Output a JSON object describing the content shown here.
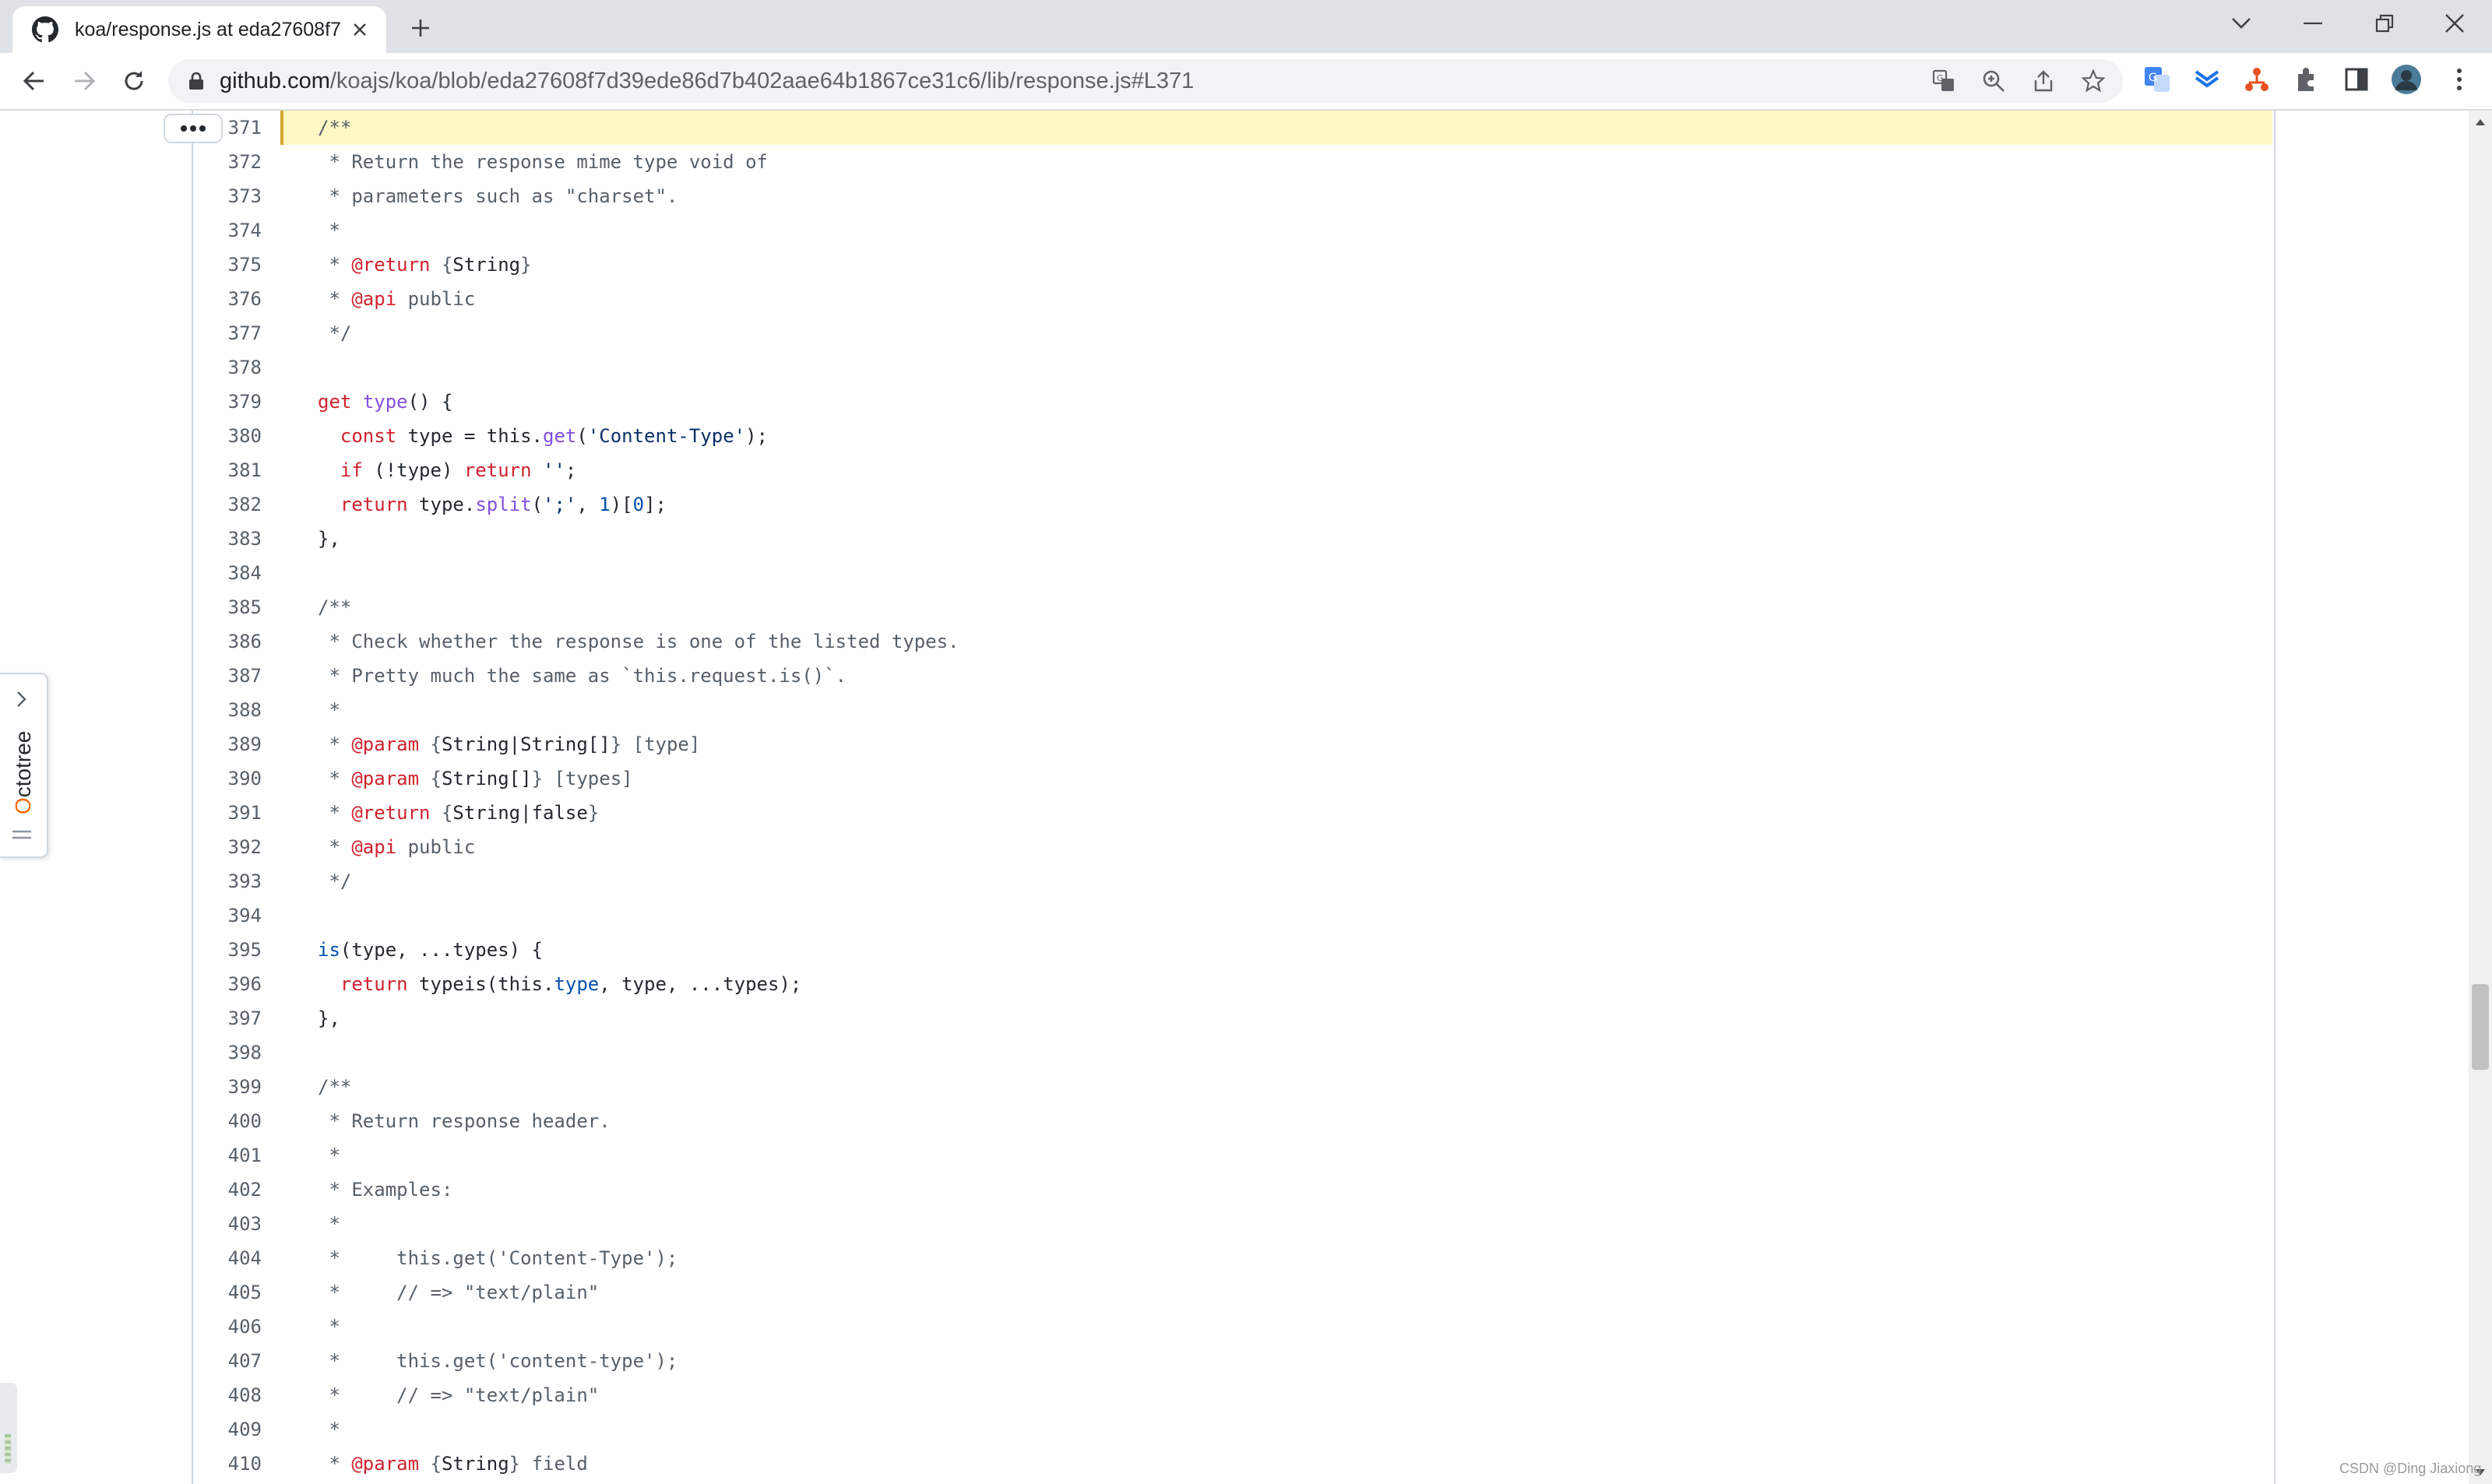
{
  "browser": {
    "tab_title": "koa/response.js at eda27608f7",
    "url_host": "github.com",
    "url_path": "/koajs/koa/blob/eda27608f7d39ede86d7b402aae64b1867ce31c6/lib/response.js#L371"
  },
  "octotree": {
    "label_first": "O",
    "label_rest": "ctotree"
  },
  "code_lines": [
    {
      "n": "371",
      "html": "<span class=\"c\">/**</span>"
    },
    {
      "n": "372",
      "html": "<span class=\"c\"> * Return the response mime type void of</span>"
    },
    {
      "n": "373",
      "html": "<span class=\"c\"> * parameters such as \"charset\".</span>"
    },
    {
      "n": "374",
      "html": "<span class=\"c\"> *</span>"
    },
    {
      "n": "375",
      "html": "<span class=\"c\"> * </span><span class=\"k\">@return</span><span class=\"c\"> {</span>String<span class=\"c\">}</span>"
    },
    {
      "n": "376",
      "html": "<span class=\"c\"> * </span><span class=\"k\">@api</span><span class=\"c\"> public</span>"
    },
    {
      "n": "377",
      "html": "<span class=\"c\"> */</span>"
    },
    {
      "n": "378",
      "html": ""
    },
    {
      "n": "379",
      "html": "<span class=\"k\">get</span> <span class=\"f\">type</span>() {"
    },
    {
      "n": "380",
      "html": "  <span class=\"k\">const</span> type = this.<span class=\"f\">get</span>(<span class=\"s\">'Content-Type'</span>);"
    },
    {
      "n": "381",
      "html": "  <span class=\"k\">if</span> (!type) <span class=\"k\">return</span> <span class=\"s\">''</span>;"
    },
    {
      "n": "382",
      "html": "  <span class=\"k\">return</span> type.<span class=\"f\">split</span>(<span class=\"s\">';'</span>, <span class=\"n\">1</span>)[<span class=\"n\">0</span>];"
    },
    {
      "n": "383",
      "html": "},"
    },
    {
      "n": "384",
      "html": ""
    },
    {
      "n": "385",
      "html": "<span class=\"c\">/**</span>"
    },
    {
      "n": "386",
      "html": "<span class=\"c\"> * Check whether the response is one of the listed types.</span>"
    },
    {
      "n": "387",
      "html": "<span class=\"c\"> * Pretty much the same as `this.request.is()`.</span>"
    },
    {
      "n": "388",
      "html": "<span class=\"c\"> *</span>"
    },
    {
      "n": "389",
      "html": "<span class=\"c\"> * </span><span class=\"k\">@param</span><span class=\"c\"> {</span>String|String[]<span class=\"c\">} [type]</span>"
    },
    {
      "n": "390",
      "html": "<span class=\"c\"> * </span><span class=\"k\">@param</span><span class=\"c\"> {</span>String[]<span class=\"c\">} [types]</span>"
    },
    {
      "n": "391",
      "html": "<span class=\"c\"> * </span><span class=\"k\">@return</span><span class=\"c\"> {</span>String|false<span class=\"c\">}</span>"
    },
    {
      "n": "392",
      "html": "<span class=\"c\"> * </span><span class=\"k\">@api</span><span class=\"c\"> public</span>"
    },
    {
      "n": "393",
      "html": "<span class=\"c\"> */</span>"
    },
    {
      "n": "394",
      "html": ""
    },
    {
      "n": "395",
      "html": "<span class=\"n\">is</span>(type, ...types) {"
    },
    {
      "n": "396",
      "html": "  <span class=\"k\">return</span> typeis(this.<span class=\"n\">type</span>, type, ...types);"
    },
    {
      "n": "397",
      "html": "},"
    },
    {
      "n": "398",
      "html": ""
    },
    {
      "n": "399",
      "html": "<span class=\"c\">/**</span>"
    },
    {
      "n": "400",
      "html": "<span class=\"c\"> * Return response header.</span>"
    },
    {
      "n": "401",
      "html": "<span class=\"c\"> *</span>"
    },
    {
      "n": "402",
      "html": "<span class=\"c\"> * Examples:</span>"
    },
    {
      "n": "403",
      "html": "<span class=\"c\"> *</span>"
    },
    {
      "n": "404",
      "html": "<span class=\"c\"> *     this.get('Content-Type');</span>"
    },
    {
      "n": "405",
      "html": "<span class=\"c\"> *     // =&gt; \"text/plain\"</span>"
    },
    {
      "n": "406",
      "html": "<span class=\"c\"> *</span>"
    },
    {
      "n": "407",
      "html": "<span class=\"c\"> *     this.get('content-type');</span>"
    },
    {
      "n": "408",
      "html": "<span class=\"c\"> *     // =&gt; \"text/plain\"</span>"
    },
    {
      "n": "409",
      "html": "<span class=\"c\"> *</span>"
    },
    {
      "n": "410",
      "html": "<span class=\"c\"> * </span><span class=\"k\">@param</span><span class=\"c\"> {</span>String<span class=\"c\">} field</span>"
    }
  ],
  "watermark": "CSDN @Ding Jiaxiong",
  "colors": {
    "highlight_bg": "#fff8c5",
    "keyword": "#cf222e",
    "function": "#8250df",
    "string": "#0a3069",
    "constant": "#0550ae",
    "comment": "#57606a"
  }
}
